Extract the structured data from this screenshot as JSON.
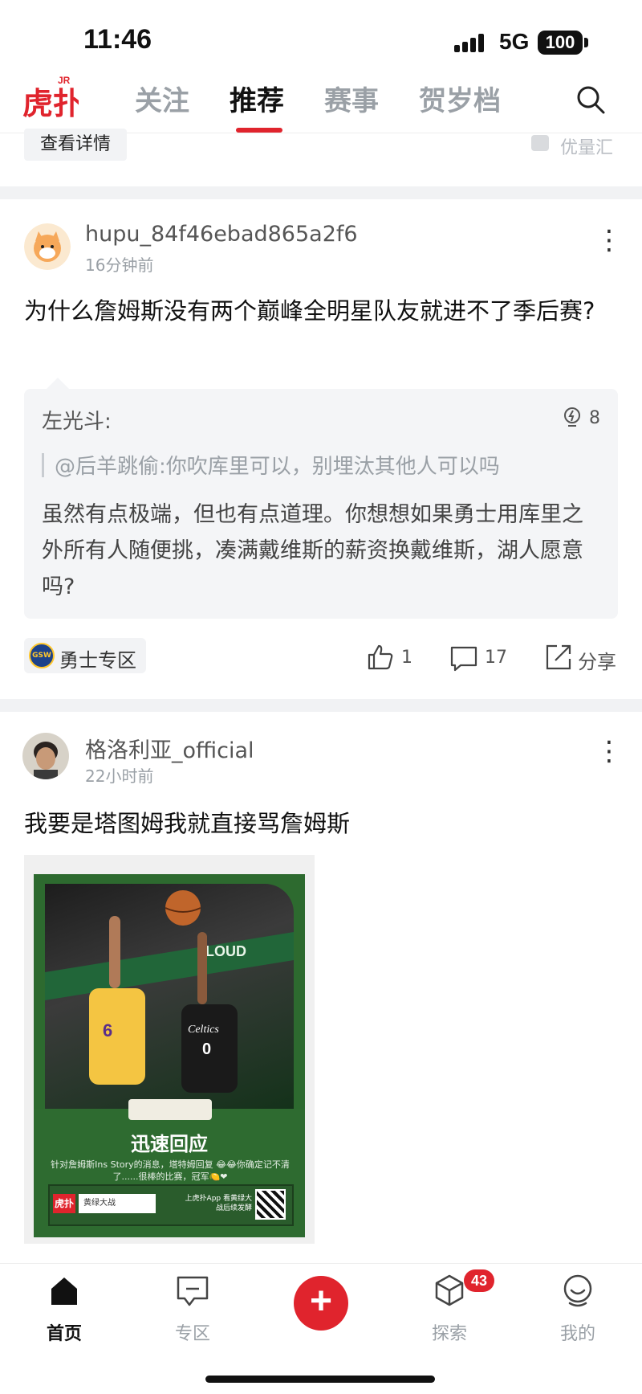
{
  "status_bar": {
    "time": "11:46",
    "network": "5G",
    "battery": "100"
  },
  "top_nav": {
    "logo_text": "虎扑",
    "logo_badge": "JR",
    "tabs": [
      {
        "label": "关注",
        "active": false
      },
      {
        "label": "推荐",
        "active": true
      },
      {
        "label": "赛事",
        "active": false
      },
      {
        "label": "贺岁档",
        "active": false
      }
    ],
    "accent_color": "#e0242d"
  },
  "ad_remnant": {
    "detail_button": "查看详情",
    "source": "优量汇"
  },
  "posts": [
    {
      "username": "hupu_84f46ebad865a2f6",
      "time": "16分钟前",
      "title": "为什么詹姆斯没有两个巅峰全明星队友就进不了季后赛?",
      "quote": {
        "author": "左光斗:",
        "likes": "8",
        "reply_to": "@后羊跳偷:你吹库里可以，别埋汰其他人可以吗",
        "body": "虽然有点极端，但也有点道理。你想想如果勇士用库里之外所有人随便挑，凑满戴维斯的薪资换戴维斯，湖人愿意吗?"
      },
      "zone": {
        "logo": "GSW",
        "label": "勇士专区"
      },
      "actions": {
        "likes": "1",
        "comments": "17",
        "share": "分享"
      }
    },
    {
      "username": "格洛利亚_official",
      "time": "22小时前",
      "title": "我要是塔图姆我就直接骂詹姆斯",
      "image": {
        "headline": "迅速回应",
        "subtext": "针对詹姆斯Ins Story的消息，塔特姆回复 😂😂你确定记不清了......很棒的比赛，冠军🍋❤",
        "brand": "虎扑",
        "search": "黄绿大战",
        "download": "上虎扑App 看黄绿大战后续发酵",
        "jersey_left": "6",
        "jersey_right": "0",
        "team_text": "Celtics",
        "banner_text": "LOUD"
      }
    }
  ],
  "bottom_nav": {
    "items": [
      {
        "label": "首页",
        "icon": "home-icon",
        "active": true
      },
      {
        "label": "专区",
        "icon": "zone-icon",
        "active": false
      },
      {
        "label": "探索",
        "icon": "explore-icon",
        "active": false,
        "badge": "43"
      },
      {
        "label": "我的",
        "icon": "profile-icon",
        "active": false
      }
    ],
    "fab": "+"
  }
}
